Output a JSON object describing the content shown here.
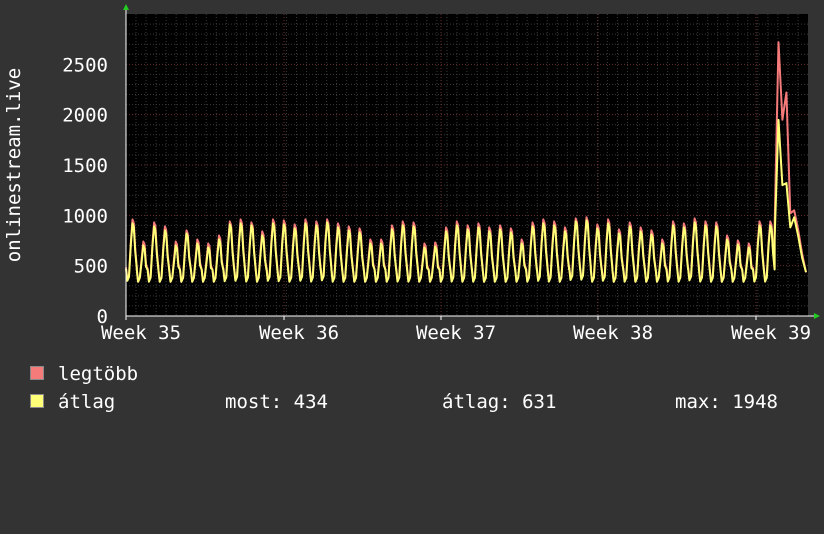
{
  "chart_data": {
    "type": "line",
    "ylabel": "onlinestream.live",
    "ylim": [
      0,
      3000
    ],
    "y_ticks": [
      0,
      500,
      1000,
      1500,
      2000,
      2500
    ],
    "x_ticks": [
      "Week 35",
      "Week 36",
      "Week 37",
      "Week 38",
      "Week 39"
    ],
    "grid": true,
    "colors": {
      "background": "#333333",
      "plot": "#000000",
      "grid": "#575757",
      "axis": "#ffffff",
      "max_series": "#f57a7a",
      "avg_series": "#ffff78",
      "arrow": "#22cc22"
    },
    "series": [
      {
        "name": "legtöbb",
        "color": "#f57a7a",
        "day_peaks": [
          960,
          740,
          930,
          890,
          740,
          850,
          760,
          720,
          800,
          940,
          960,
          930,
          840,
          960,
          950,
          910,
          960,
          940,
          960,
          920,
          890,
          870,
          760,
          760,
          900,
          940,
          930,
          720,
          730,
          880,
          940,
          900,
          920,
          880,
          900,
          870,
          760,
          930,
          960,
          940,
          880,
          970,
          980,
          910,
          960,
          860,
          930,
          880,
          850,
          760,
          940,
          920,
          970,
          940,
          930,
          800,
          750,
          720,
          940,
          940
        ]
      },
      {
        "name": "átlag",
        "color": "#ffff78",
        "day_peaks": [
          920,
          700,
          890,
          850,
          700,
          820,
          720,
          680,
          760,
          910,
          920,
          900,
          800,
          920,
          910,
          870,
          920,
          900,
          930,
          880,
          850,
          830,
          720,
          720,
          860,
          900,
          890,
          680,
          690,
          840,
          900,
          860,
          880,
          840,
          860,
          830,
          720,
          890,
          920,
          900,
          840,
          940,
          950,
          870,
          920,
          820,
          890,
          840,
          810,
          720,
          900,
          880,
          930,
          900,
          890,
          760,
          710,
          680,
          900,
          900
        ]
      }
    ],
    "tail": {
      "max": [
        880,
        2720,
        1950,
        2220,
        1020,
        1050,
        860,
        620,
        434
      ],
      "avg": [
        760,
        1948,
        1300,
        1320,
        880,
        980,
        800,
        580,
        434
      ]
    },
    "legend": {
      "max_label": "legtöbb",
      "avg_label": "átlag"
    },
    "stats": {
      "now": "most: 434",
      "avg": "átlag: 631",
      "max": "max: 1948"
    }
  }
}
